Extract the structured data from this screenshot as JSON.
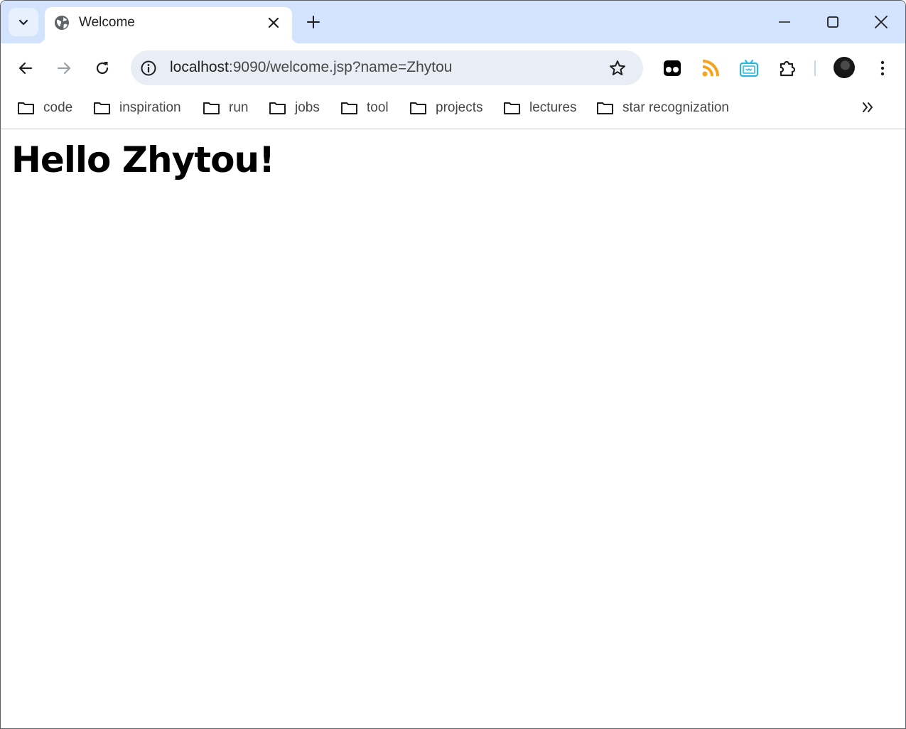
{
  "window": {
    "tab": {
      "title": "Welcome",
      "favicon": "globe-icon"
    },
    "controls": [
      "tab-search-chevron-icon",
      "close-tab-icon",
      "new-tab-icon",
      "minimize-icon",
      "maximize-icon",
      "close-window-icon"
    ]
  },
  "toolbar": {
    "url_host": "localhost",
    "url_path": ":9090/welcome.jsp?name=Zhytou",
    "icons": [
      "back-icon",
      "forward-icon",
      "reload-icon",
      "site-info-icon",
      "bookmark-star-icon",
      "extension-1-icon",
      "rss-icon",
      "tv-extension-icon",
      "extensions-puzzle-icon",
      "profile-avatar",
      "menu-icon"
    ]
  },
  "bookmarks": {
    "items": [
      {
        "label": "code"
      },
      {
        "label": "inspiration"
      },
      {
        "label": "run"
      },
      {
        "label": "jobs"
      },
      {
        "label": "tool"
      },
      {
        "label": "projects"
      },
      {
        "label": "lectures"
      },
      {
        "label": "star recognization"
      }
    ],
    "overflow_icon": "chevron-double-right-icon"
  },
  "page": {
    "heading": "Hello Zhytou!"
  },
  "colors": {
    "tabstrip_bg": "#d3e3fd",
    "omnibox_bg": "#e9eef6",
    "rss_orange": "#f7a21b",
    "tv_cyan": "#29b6e0"
  }
}
